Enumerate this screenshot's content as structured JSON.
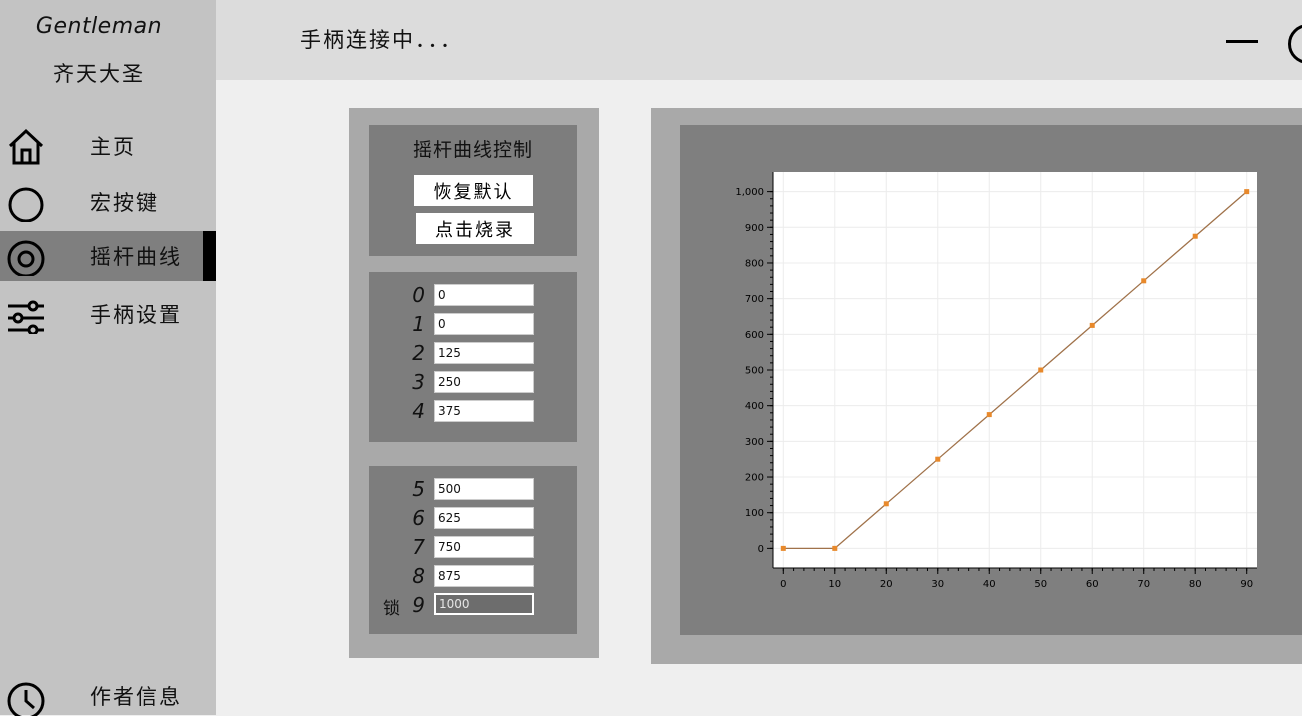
{
  "sidebar": {
    "brand_title": "Gentleman",
    "brand_subtitle": "齐天大圣",
    "items": [
      {
        "label": "主页",
        "icon": "home-icon"
      },
      {
        "label": "宏按键",
        "icon": "circle-icon"
      },
      {
        "label": "摇杆曲线",
        "icon": "target-icon",
        "active": true
      },
      {
        "label": "手柄设置",
        "icon": "sliders-icon"
      },
      {
        "label": "作者信息",
        "icon": "clock-icon"
      }
    ]
  },
  "header": {
    "status": "手柄连接中．．．"
  },
  "controls": {
    "title": "摇杆曲线控制",
    "reset_label": "恢复默认",
    "burn_label": "点击烧录",
    "lock_label": "锁",
    "rows": [
      {
        "index": "0",
        "value": "0"
      },
      {
        "index": "1",
        "value": "0"
      },
      {
        "index": "2",
        "value": "125"
      },
      {
        "index": "3",
        "value": "250"
      },
      {
        "index": "4",
        "value": "375"
      },
      {
        "index": "5",
        "value": "500"
      },
      {
        "index": "6",
        "value": "625"
      },
      {
        "index": "7",
        "value": "750"
      },
      {
        "index": "8",
        "value": "875"
      },
      {
        "index": "9",
        "value": "1000"
      }
    ]
  },
  "chart_data": {
    "type": "line",
    "x": [
      0,
      10,
      20,
      30,
      40,
      50,
      60,
      70,
      80,
      90
    ],
    "series": [
      {
        "values": [
          0,
          0,
          125,
          250,
          375,
          500,
          625,
          750,
          875,
          1000
        ]
      }
    ],
    "xlim": [
      -2,
      92
    ],
    "ylim": [
      -55,
      1055
    ],
    "xticks": [
      "0",
      "10",
      "20",
      "30",
      "40",
      "50",
      "60",
      "70",
      "80",
      "90"
    ],
    "yticks": [
      "0",
      "100",
      "200",
      "300",
      "400",
      "500",
      "600",
      "700",
      "800",
      "900",
      "1,000"
    ],
    "ytick_values": [
      0,
      100,
      200,
      300,
      400,
      500,
      600,
      700,
      800,
      900,
      1000
    ],
    "grid": true,
    "line_color": "#a0724a",
    "marker_color": "#e8892b"
  }
}
